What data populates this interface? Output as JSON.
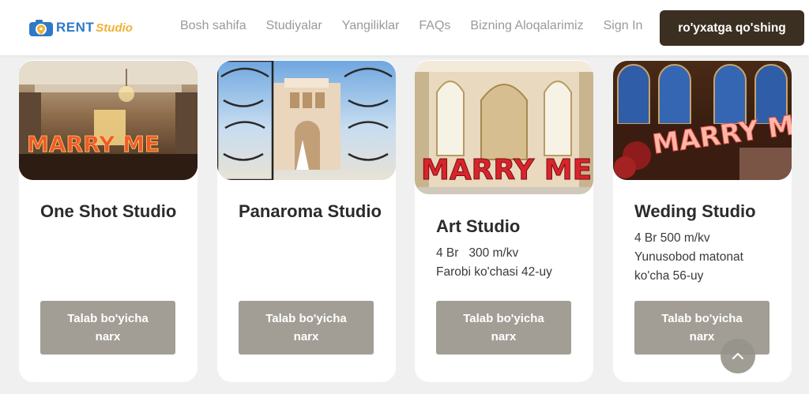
{
  "brand": {
    "rent": "RENT",
    "studio": "Studio",
    "icon": "camera-location-icon",
    "colors": {
      "rent": "#2e79c8",
      "studio": "#f2b134"
    }
  },
  "nav": {
    "links": [
      "Bosh sahifa",
      "Studiyalar",
      "Yangiliklar",
      "FAQs",
      "Bizning Aloqalarimiz",
      "Sign In"
    ],
    "signup_label": "ro'yxatga qo'shing"
  },
  "cards": [
    {
      "title": "One Shot Studio",
      "details": [],
      "button": "Talab bo'yicha narx",
      "image_text": "MARRY ME"
    },
    {
      "title": "Panaroma Studio",
      "details": [],
      "button": "Talab bo'yicha narx"
    },
    {
      "title": "Art Studio",
      "details": [
        "4 Br   300 m/kv",
        "Farobi ko'chasi 42-uy"
      ],
      "button": "Talab bo'yicha narx",
      "image_text": "MARRY ME"
    },
    {
      "title": "Weding Studio",
      "details": [
        "4 Br 500 m/kv",
        "Yunusobod matonat ko'cha 56-uy"
      ],
      "button": "Talab bo'yicha narx",
      "image_text": "MARRY ME"
    }
  ],
  "scroll_top": {
    "icon": "chevron-up-icon"
  },
  "colors": {
    "primary_button": "#3b2f21",
    "price_button": "#a29e95",
    "page_bg": "#eff0ef"
  }
}
